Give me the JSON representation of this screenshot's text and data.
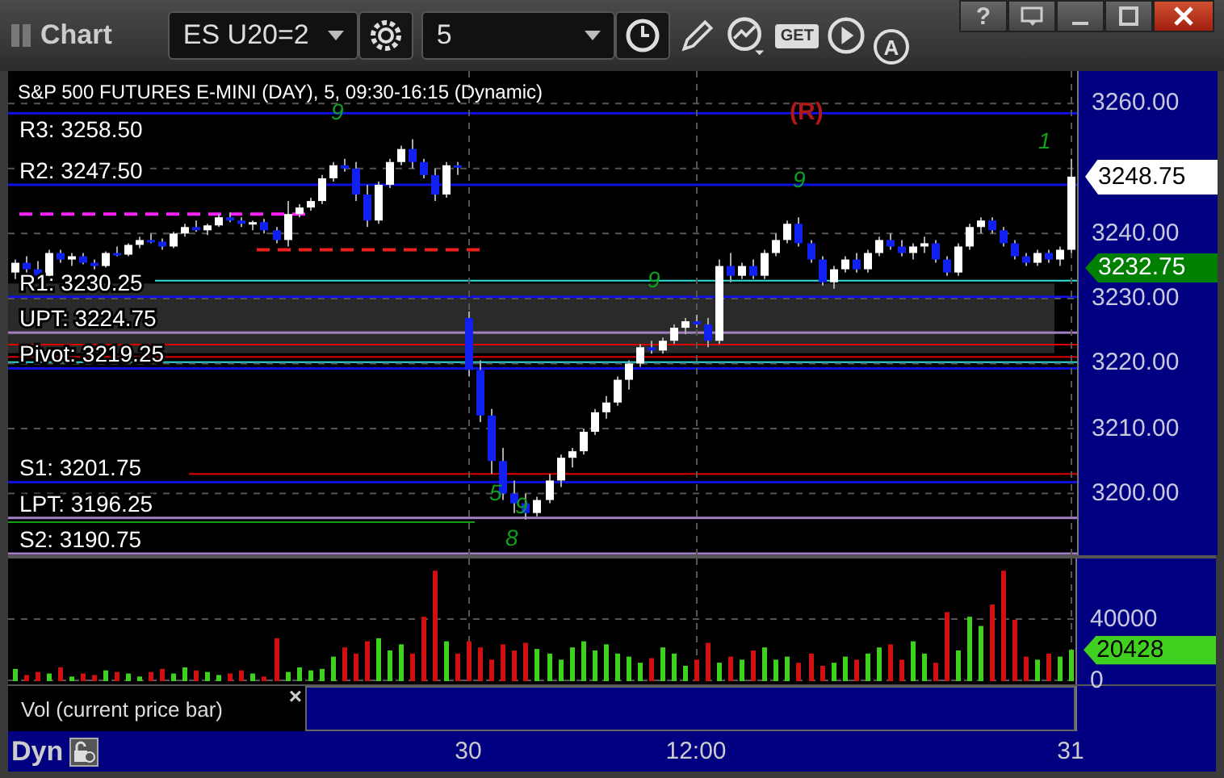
{
  "window": {
    "title": "Chart",
    "buttons": [
      {
        "kind": "help",
        "label": "?"
      },
      {
        "kind": "dock"
      },
      {
        "kind": "minimize"
      },
      {
        "kind": "maximize"
      },
      {
        "kind": "close"
      }
    ]
  },
  "toolbar": {
    "symbol": "ES U20=2",
    "interval": "5",
    "tools": [
      {
        "kind": "pencil"
      },
      {
        "kind": "studies"
      },
      {
        "kind": "get",
        "label": "GET"
      },
      {
        "kind": "play"
      },
      {
        "kind": "alert",
        "label": "A"
      }
    ]
  },
  "chart": {
    "title": "S&P 500 FUTURES E-MINI (DAY), 5, 09:30-16:15 (Dynamic)",
    "levels": [
      {
        "label": "R3: 3258.50",
        "color": "#1010e0"
      },
      {
        "label": "R2: 3247.50",
        "color": "#1010e0"
      },
      {
        "label": "R1: 3230.25",
        "color": "#1010e0"
      },
      {
        "label": "UPT: 3224.75",
        "color": "#a080c0"
      },
      {
        "label": "Pivot: 3219.25",
        "color": "#1010e0"
      },
      {
        "label": "S1: 3201.75",
        "color": "#1010e0"
      },
      {
        "label": "LPT: 3196.25",
        "color": "#a080c0"
      },
      {
        "label": "S2: 3190.75",
        "color": "#a080c0"
      }
    ],
    "marks": [
      {
        "kind": "reversal",
        "text": "(R)"
      },
      {
        "kind": "count",
        "text": "1"
      },
      {
        "kind": "count",
        "text": "9"
      },
      {
        "kind": "count",
        "text": "9"
      },
      {
        "kind": "count",
        "text": "9"
      },
      {
        "kind": "count",
        "text": "5"
      },
      {
        "kind": "count",
        "text": "9"
      },
      {
        "kind": "count",
        "text": "8"
      }
    ],
    "chart_data": {
      "type": "candlestick",
      "ylim": [
        3190.5,
        3265
      ],
      "grid": true,
      "ohlc": [
        [
          3234,
          3236,
          3233,
          3235.5
        ],
        [
          3235.5,
          3236.5,
          3234,
          3234.5
        ],
        [
          3234.5,
          3235.75,
          3233,
          3233.5
        ],
        [
          3233.5,
          3237.5,
          3233,
          3237
        ],
        [
          3237,
          3237.5,
          3235.5,
          3236
        ],
        [
          3236,
          3237,
          3235,
          3236.5
        ],
        [
          3236.5,
          3237,
          3235.25,
          3235.5
        ],
        [
          3235.5,
          3236,
          3234.5,
          3235
        ],
        [
          3235,
          3237.25,
          3234.75,
          3237
        ],
        [
          3237,
          3238,
          3236.5,
          3236.75
        ],
        [
          3236.75,
          3238.5,
          3236.5,
          3238.25
        ],
        [
          3238.25,
          3239.5,
          3237.75,
          3239
        ],
        [
          3239,
          3240,
          3238.5,
          3238.75
        ],
        [
          3238.75,
          3239.25,
          3237.5,
          3238
        ],
        [
          3238,
          3240.25,
          3237.75,
          3240
        ],
        [
          3240,
          3241.5,
          3239.5,
          3241
        ],
        [
          3241,
          3242,
          3240.25,
          3240.5
        ],
        [
          3240.5,
          3241.5,
          3239.75,
          3241.25
        ],
        [
          3241.25,
          3243,
          3241,
          3242.5
        ],
        [
          3242.5,
          3243.25,
          3241.75,
          3242
        ],
        [
          3242,
          3242.5,
          3241,
          3241.5
        ],
        [
          3241.5,
          3242,
          3240.5,
          3241.75
        ],
        [
          3241.75,
          3242.25,
          3240,
          3240.5
        ],
        [
          3240.5,
          3241,
          3238.5,
          3239
        ],
        [
          3239,
          3245,
          3238,
          3243
        ],
        [
          3243,
          3244.5,
          3242.5,
          3244
        ],
        [
          3244,
          3245.5,
          3243.5,
          3245
        ],
        [
          3245,
          3249,
          3244.5,
          3248.5
        ],
        [
          3248.5,
          3251,
          3248,
          3250.5
        ],
        [
          3250.5,
          3251.5,
          3249.5,
          3250
        ],
        [
          3250,
          3251,
          3245,
          3246
        ],
        [
          3246,
          3247.5,
          3241,
          3242
        ],
        [
          3242,
          3248,
          3241.5,
          3247.5
        ],
        [
          3247.5,
          3251.5,
          3247,
          3251
        ],
        [
          3251,
          3253.5,
          3250.5,
          3253
        ],
        [
          3253,
          3254.5,
          3250,
          3251
        ],
        [
          3251,
          3251.5,
          3248.5,
          3249
        ],
        [
          3249,
          3250,
          3245,
          3246
        ],
        [
          3246,
          3251,
          3245.5,
          3250.5
        ],
        [
          3250.5,
          3251,
          3249,
          3250.25
        ],
        [
          3227,
          3228,
          3218,
          3219
        ],
        [
          3219,
          3220.5,
          3211,
          3212
        ],
        [
          3212,
          3213,
          3203,
          3205
        ],
        [
          3205,
          3207,
          3199,
          3200
        ],
        [
          3200,
          3202,
          3197,
          3198.5
        ],
        [
          3198.5,
          3200,
          3196,
          3197
        ],
        [
          3197,
          3199.5,
          3196.5,
          3199
        ],
        [
          3199,
          3203,
          3198.5,
          3202
        ],
        [
          3202,
          3206,
          3201,
          3205.5
        ],
        [
          3205.5,
          3207,
          3204,
          3206.5
        ],
        [
          3206.5,
          3210,
          3206,
          3209.5
        ],
        [
          3209.5,
          3213,
          3209,
          3212.5
        ],
        [
          3212.5,
          3215,
          3211.5,
          3214
        ],
        [
          3214,
          3218,
          3213.5,
          3217.5
        ],
        [
          3217.5,
          3220.5,
          3216,
          3220
        ],
        [
          3220,
          3223,
          3219.5,
          3222.5
        ],
        [
          3222.5,
          3223.5,
          3221.5,
          3222
        ],
        [
          3222,
          3224,
          3221.5,
          3223.5
        ],
        [
          3223.5,
          3226,
          3223,
          3225.5
        ],
        [
          3225.5,
          3227,
          3224.5,
          3226.5
        ],
        [
          3226.5,
          3227.5,
          3225.5,
          3226
        ],
        [
          3226,
          3227,
          3222.5,
          3223.5
        ],
        [
          3223.5,
          3236,
          3223,
          3235
        ],
        [
          3235,
          3237,
          3232.5,
          3233.5
        ],
        [
          3233.5,
          3235.5,
          3233,
          3235
        ],
        [
          3235,
          3236,
          3233,
          3233.5
        ],
        [
          3233.5,
          3237.5,
          3233,
          3237
        ],
        [
          3237,
          3240,
          3236.5,
          3239
        ],
        [
          3239,
          3242,
          3238.5,
          3241.5
        ],
        [
          3241.5,
          3242.5,
          3238,
          3238.5
        ],
        [
          3238.5,
          3239,
          3235.5,
          3236
        ],
        [
          3236,
          3236.5,
          3232,
          3232.5
        ],
        [
          3232.5,
          3235,
          3231.5,
          3234.5
        ],
        [
          3234.5,
          3236.5,
          3234,
          3236
        ],
        [
          3236,
          3237,
          3234,
          3234.5
        ],
        [
          3234.5,
          3237.5,
          3234,
          3237
        ],
        [
          3237,
          3239.5,
          3236.5,
          3239
        ],
        [
          3239,
          3240,
          3237.5,
          3238
        ],
        [
          3238,
          3239,
          3236.5,
          3237
        ],
        [
          3237,
          3238.5,
          3236,
          3238
        ],
        [
          3238,
          3239.5,
          3237,
          3238.5
        ],
        [
          3238.5,
          3239,
          3235.5,
          3236
        ],
        [
          3236,
          3236.5,
          3233.5,
          3234
        ],
        [
          3234,
          3238.5,
          3233.5,
          3238
        ],
        [
          3238,
          3241.5,
          3237.5,
          3241
        ],
        [
          3241,
          3242.5,
          3240,
          3242
        ],
        [
          3242,
          3242.5,
          3240,
          3240.5
        ],
        [
          3240.5,
          3241,
          3238,
          3238.5
        ],
        [
          3238.5,
          3239,
          3236,
          3236.5
        ],
        [
          3236.5,
          3237,
          3235,
          3235.5
        ],
        [
          3235.5,
          3237.5,
          3235,
          3237
        ],
        [
          3237,
          3237.5,
          3235.5,
          3236
        ],
        [
          3236,
          3238,
          3235,
          3237.5
        ],
        [
          3237.5,
          3251.5,
          3237,
          3248.75
        ]
      ],
      "yticks": [
        {
          "value": 3260,
          "label": "3260.00"
        },
        {
          "value": 3240,
          "label": "3240.00"
        },
        {
          "value": 3230,
          "label": "3230.00"
        },
        {
          "value": 3220,
          "label": "3220.00"
        },
        {
          "value": 3210,
          "label": "3210.00"
        },
        {
          "value": 3200,
          "label": "3200.00"
        }
      ]
    },
    "last_price": "3248.75",
    "level_tag": "3232.75"
  },
  "volume": {
    "last": "20428",
    "tab": "Vol (current price bar)",
    "close": "×",
    "chart_data": {
      "type": "bar",
      "values": [
        8000,
        4000,
        6000,
        5000,
        9000,
        3000,
        5000,
        4000,
        7000,
        6000,
        5000,
        3000,
        6000,
        8000,
        5000,
        9000,
        7000,
        6000,
        4000,
        5000,
        7000,
        5000,
        3000,
        28000,
        6000,
        9000,
        7000,
        8000,
        16000,
        22000,
        18000,
        26000,
        28000,
        20000,
        24000,
        18000,
        42000,
        72000,
        26000,
        18000,
        26000,
        22000,
        14000,
        24000,
        20000,
        25000,
        21000,
        18000,
        14000,
        22000,
        26000,
        20000,
        24000,
        18000,
        16000,
        12000,
        15000,
        22000,
        18000,
        10000,
        14000,
        25000,
        12000,
        16000,
        14000,
        20000,
        22000,
        14000,
        16000,
        12000,
        18000,
        10000,
        12000,
        16000,
        14000,
        18000,
        22000,
        24000,
        14000,
        26000,
        18000,
        12000,
        45000,
        20000,
        42000,
        36000,
        50000,
        72000,
        40000,
        16000,
        14000,
        18000,
        16000,
        20428
      ],
      "ylim": [
        0,
        80000
      ],
      "grid": true,
      "yticks": [
        {
          "value": 40000,
          "label": "40000"
        },
        {
          "value": 0,
          "label": "0"
        }
      ]
    }
  },
  "time_axis": {
    "mode": "Dyn",
    "labels": [
      "30",
      "12:00",
      "31"
    ]
  }
}
